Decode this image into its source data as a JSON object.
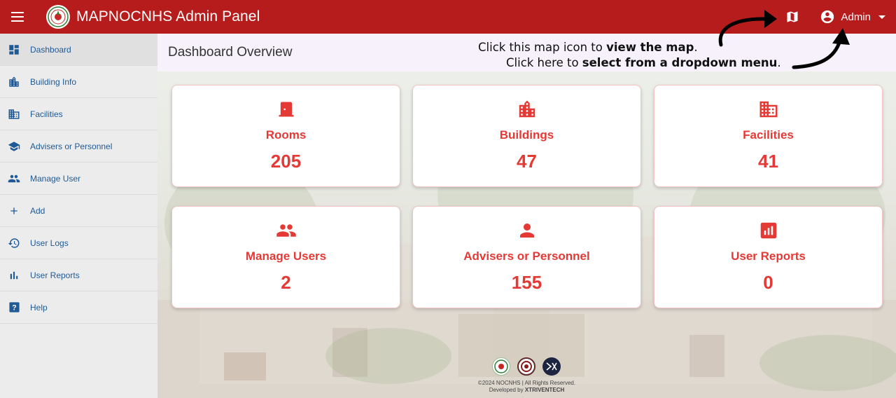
{
  "topbar": {
    "title": "MAPNOCNHS Admin Panel",
    "admin_label": "Admin",
    "bg_color": "#b71c1c",
    "icons": [
      "menu-icon",
      "school-seal-logo",
      "map-icon",
      "account-circle-icon",
      "caret-down-icon"
    ]
  },
  "sidebar": {
    "items": [
      {
        "label": "Dashboard",
        "icon": "dashboard-icon",
        "active": true
      },
      {
        "label": "Building Info",
        "icon": "building-icon"
      },
      {
        "label": "Facilities",
        "icon": "facilities-icon"
      },
      {
        "label": "Advisers or Personnel",
        "icon": "graduation-cap-icon"
      },
      {
        "label": "Manage User",
        "icon": "people-icon"
      },
      {
        "label": "Add",
        "icon": "plus-icon"
      },
      {
        "label": "User Logs",
        "icon": "history-icon"
      },
      {
        "label": "User Reports",
        "icon": "bar-chart-icon"
      },
      {
        "label": "Help",
        "icon": "help-icon"
      }
    ]
  },
  "main": {
    "page_title": "Dashboard Overview",
    "annotation": {
      "line1_pre": "Click this map icon to ",
      "line1_bold": "view the map",
      "line1_post": ".",
      "line2_pre": "Click here to ",
      "line2_bold": "select from a dropdown menu",
      "line2_post": "."
    },
    "cards": [
      {
        "label": "Rooms",
        "value": "205",
        "icon": "door-icon"
      },
      {
        "label": "Buildings",
        "value": "47",
        "icon": "building-icon"
      },
      {
        "label": "Facilities",
        "value": "41",
        "icon": "facilities-icon"
      },
      {
        "label": "Manage Users",
        "value": "2",
        "icon": "people-icon"
      },
      {
        "label": "Advisers or Personnel",
        "value": "155",
        "icon": "person-icon"
      },
      {
        "label": "User Reports",
        "value": "0",
        "icon": "report-icon"
      }
    ],
    "accent_color": "#e53935"
  },
  "footer": {
    "copyright": "©2024 NOCNHS | All Rights Reserved.",
    "developed_by": "Developed by ",
    "developer": "XTRIVENTECH"
  }
}
